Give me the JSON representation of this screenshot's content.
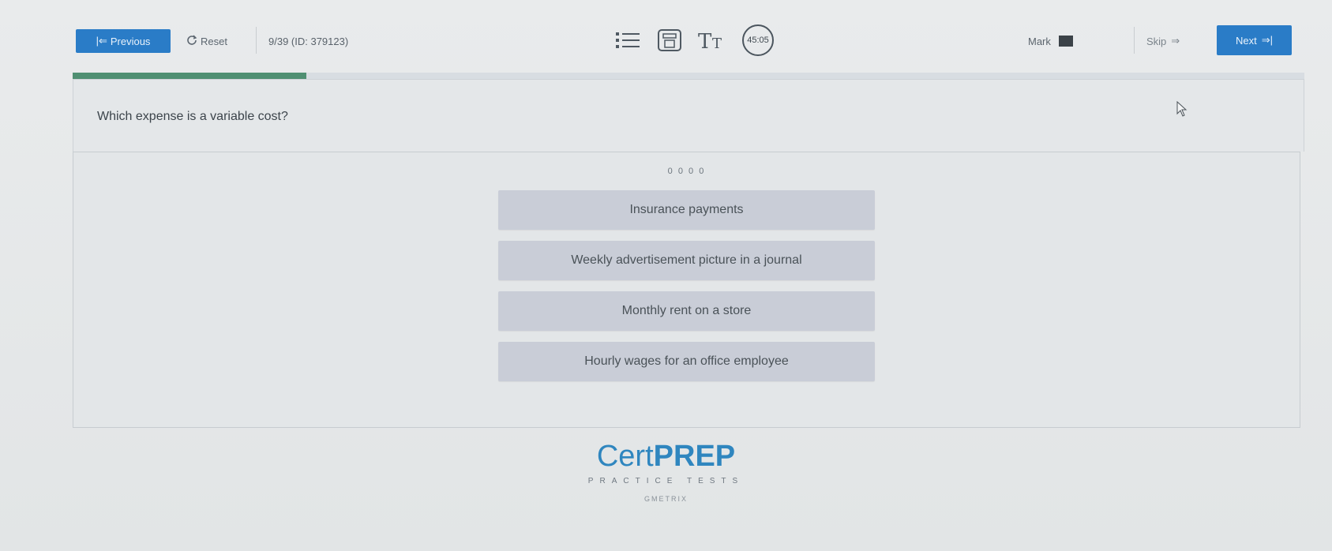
{
  "toolbar": {
    "previous_label": "Previous",
    "reset_label": "Reset",
    "question_info": "9/39 (ID: 379123)",
    "timer": "45:05",
    "mark_label": "Mark",
    "skip_label": "Skip",
    "next_label": "Next"
  },
  "progress": {
    "fraction": 0.19,
    "color": "#4f8f72"
  },
  "question": {
    "text": "Which expense is a variable cost?",
    "answer_header": "0 0 0 0"
  },
  "choices": [
    {
      "label": "Insurance payments"
    },
    {
      "label": "Weekly advertisement picture in a journal"
    },
    {
      "label": "Monthly rent on a store"
    },
    {
      "label": "Hourly wages for an office employee"
    }
  ],
  "brand": {
    "name_light": "Cert",
    "name_bold": "PREP",
    "tagline": "PRACTICE TESTS",
    "sub": "GMETRIX",
    "color": "#2f86bf"
  },
  "colors": {
    "accent": "#2a7cc7",
    "choice_bg": "#c9cdd7"
  },
  "icons": [
    "previous-arrow-icon",
    "reset-icon",
    "list-icon",
    "calculator-icon",
    "text-size-icon",
    "timer-icon",
    "skip-icon",
    "next-arrow-icon",
    "cursor-icon"
  ]
}
